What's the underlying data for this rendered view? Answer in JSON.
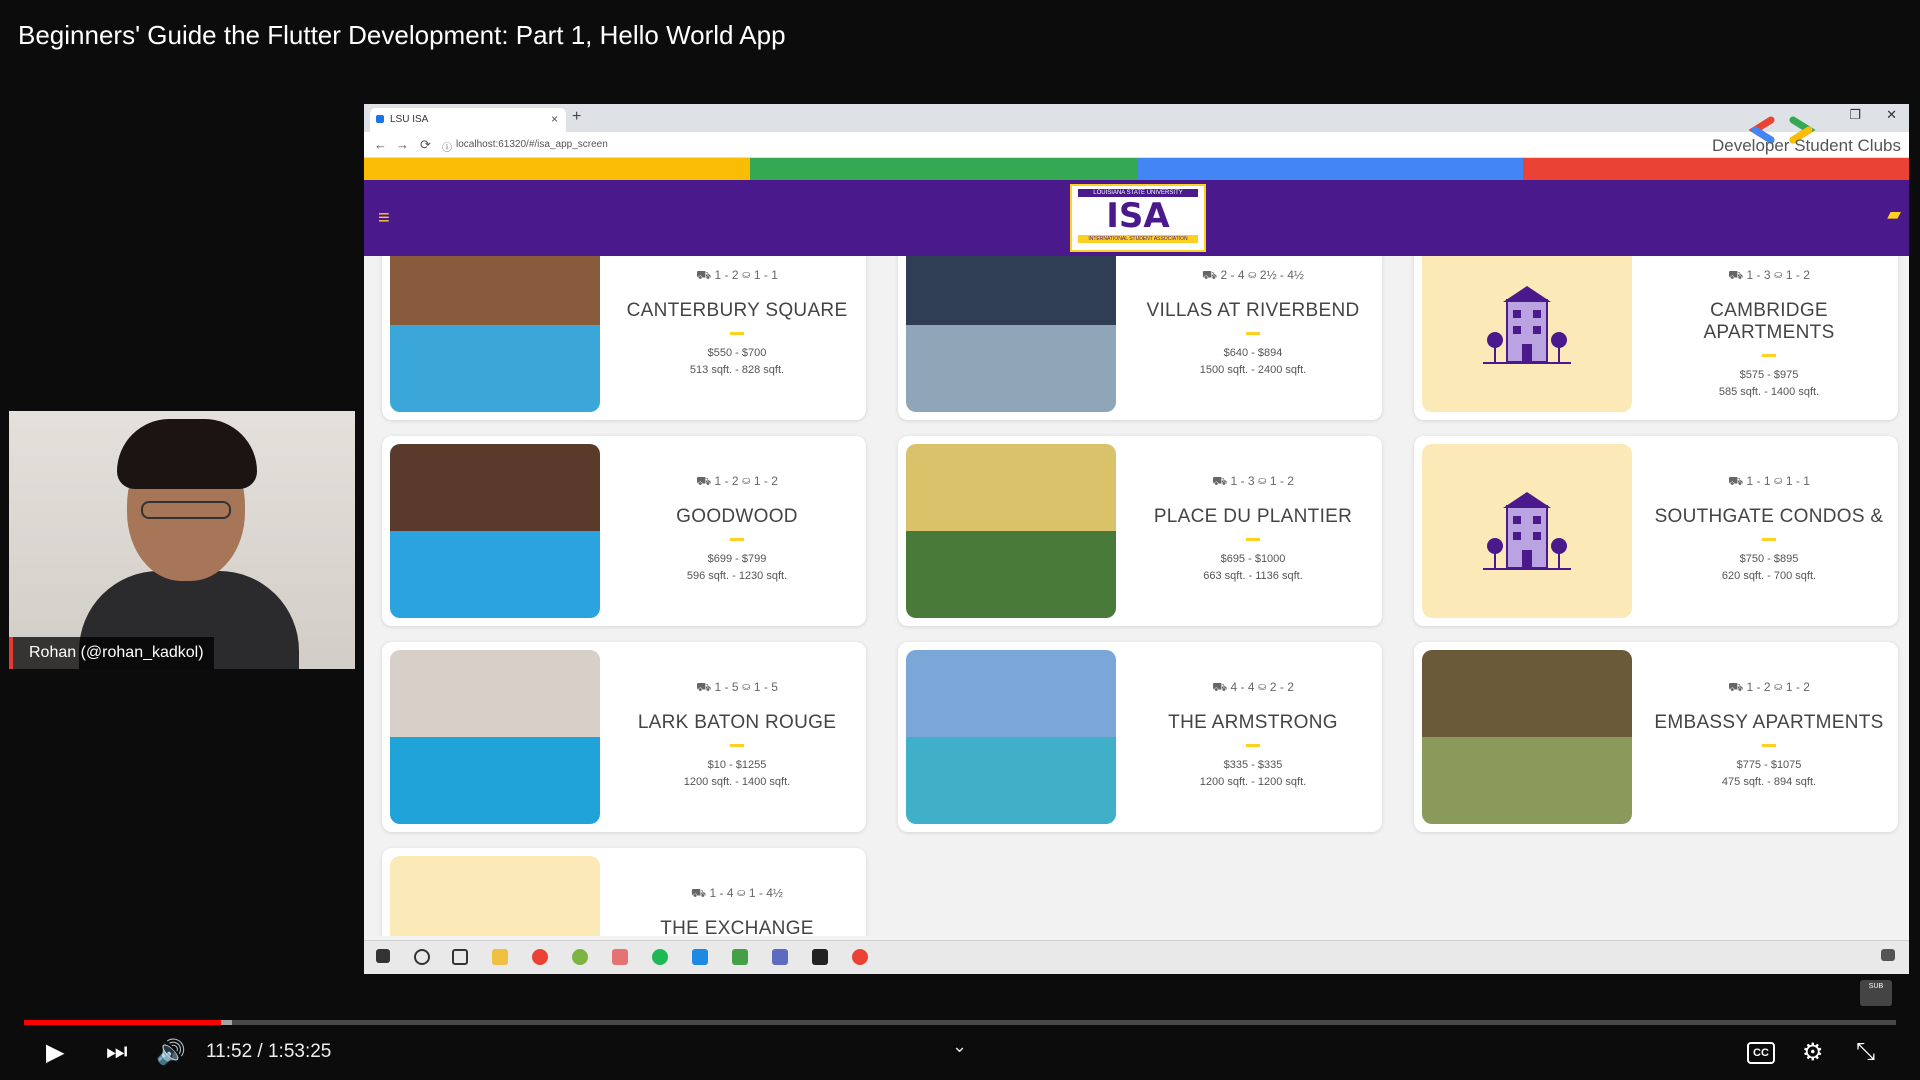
{
  "video": {
    "title": "Beginners' Guide the Flutter Development: Part 1, Hello World App"
  },
  "webcam": {
    "name": "Rohan (@rohan_kadkol)"
  },
  "browser": {
    "tab_title": "LSU ISA",
    "new_tab": "+",
    "close_tab": "×",
    "url": "localhost:61320/#/isa_app_screen",
    "overlay_brand": "Developer Student Clubs"
  },
  "app": {
    "logo_top": "LOUISIANA STATE UNIVERSITY",
    "logo_main": "ISA",
    "logo_bottom": "INTERNATIONAL STUDENT ASSOCIATION",
    "colors": {
      "header": "#4a1a8c",
      "accent": "#fdd023"
    },
    "stripe_colors": [
      "#fbbc05",
      "#34a853",
      "#4285f4",
      "#ea4335"
    ]
  },
  "listings": [
    {
      "name": "CANTERBURY SQUARE",
      "beds": "1 - 2",
      "baths": "1 - 1",
      "price": "$550 - $700",
      "sqft": "513 sqft. - 828 sqft."
    },
    {
      "name": "VILLAS AT RIVERBEND",
      "beds": "2 - 4",
      "baths": "2½ - 4½",
      "price": "$640 - $894",
      "sqft": "1500 sqft. - 2400 sqft."
    },
    {
      "name": "CAMBRIDGE APARTMENTS",
      "beds": "1 - 3",
      "baths": "1 - 2",
      "price": "$575 - $975",
      "sqft": "585 sqft. - 1400 sqft."
    },
    {
      "name": "GOODWOOD",
      "beds": "1 - 2",
      "baths": "1 - 2",
      "price": "$699 - $799",
      "sqft": "596 sqft. - 1230 sqft."
    },
    {
      "name": "PLACE DU PLANTIER",
      "beds": "1 - 3",
      "baths": "1 - 2",
      "price": "$695 - $1000",
      "sqft": "663 sqft. - 1136 sqft."
    },
    {
      "name": "SOUTHGATE CONDOS &",
      "beds": "1 - 1",
      "baths": "1 - 1",
      "price": "$750 - $895",
      "sqft": "620 sqft. - 700 sqft."
    },
    {
      "name": "LARK BATON ROUGE",
      "beds": "1 - 5",
      "baths": "1 - 5",
      "price": "$10 - $1255",
      "sqft": "1200 sqft. - 1400 sqft."
    },
    {
      "name": "THE ARMSTRONG",
      "beds": "4 - 4",
      "baths": "2 - 2",
      "price": "$335 - $335",
      "sqft": "1200 sqft. - 1200 sqft."
    },
    {
      "name": "EMBASSY APARTMENTS",
      "beds": "1 - 2",
      "baths": "1 - 2",
      "price": "$775 - $1075",
      "sqft": "475 sqft. - 894 sqft."
    },
    {
      "name": "THE EXCHANGE",
      "beds": "1 - 4",
      "baths": "1 - 4½",
      "price": "",
      "sqft": ""
    }
  ],
  "player": {
    "time": "11:52 / 1:53:25",
    "played_fraction": 0.105,
    "buffered_fraction": 0.111,
    "cc_label": "CC",
    "sub_badge": "SUB"
  }
}
